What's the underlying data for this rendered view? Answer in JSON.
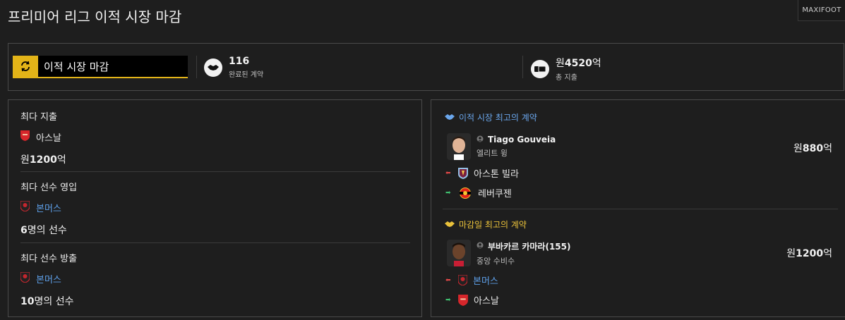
{
  "page": {
    "title": "프리미어 리그 이적 시장 마감",
    "brand": "MAXIFOOT"
  },
  "summary": {
    "deadline_label": "이적 시장 마감",
    "deals_value": "116",
    "deals_label": "완료된 계약",
    "spend_prefix": "원",
    "spend_value": "4520",
    "spend_suffix": "억",
    "spend_label": "총 지출",
    "accent_color": "#e3b418"
  },
  "left": {
    "top_spender": {
      "title": "최다 지출",
      "club": "아스날",
      "prefix": "원",
      "value": "1200",
      "suffix": "억"
    },
    "most_incoming": {
      "title": "최다 선수 영입",
      "club": "본머스",
      "value": "6",
      "suffix": "명의 선수"
    },
    "most_outgoing": {
      "title": "최다 선수 방출",
      "club": "본머스",
      "value": "10",
      "suffix": "명의 선수"
    }
  },
  "right": {
    "best_window": {
      "heading": "이적 시장 최고의 계약",
      "player": "Tiago Gouveia",
      "position": "엘리트 윙",
      "fee_prefix": "원",
      "fee_value": "880",
      "fee_suffix": "억",
      "from_club": "아스톤 빌라",
      "to_club": "레버쿠젠"
    },
    "best_deadline": {
      "heading": "마감일 최고의 계약",
      "player": "부바카르 카마라(155)",
      "position": "중앙 수비수",
      "fee_prefix": "원",
      "fee_value": "1200",
      "fee_suffix": "억",
      "from_club": "본머스",
      "to_club": "아스날"
    }
  },
  "icons": {
    "deadline": "refresh-icon",
    "deals": "handshake-icon",
    "spend": "money-icon",
    "user": "user-icon",
    "out": "arrow-left-icon",
    "in": "arrow-right-icon"
  }
}
